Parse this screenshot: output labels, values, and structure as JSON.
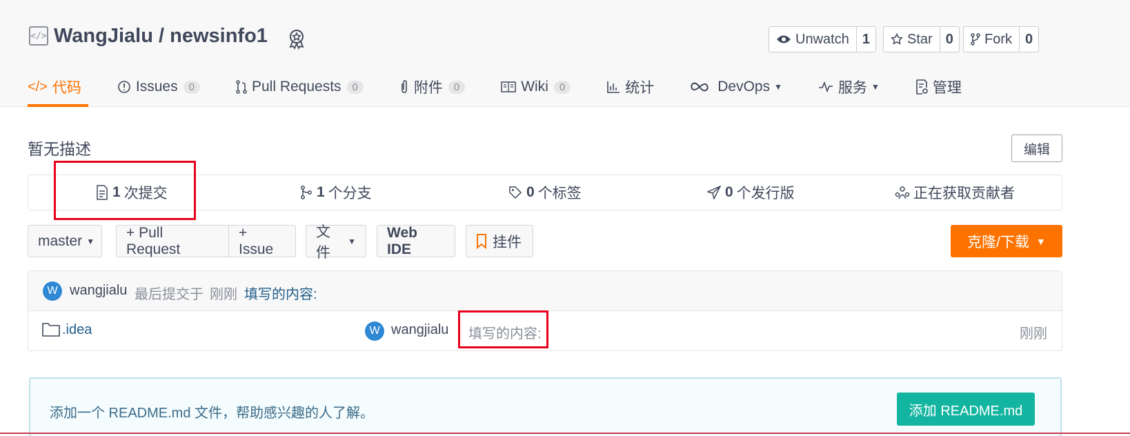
{
  "repo": {
    "owner": "WangJialu",
    "sep": " / ",
    "name": "newsinfo1"
  },
  "actions": [
    {
      "label": "Unwatch",
      "count": "1",
      "icon": "eye-icon"
    },
    {
      "label": "Star",
      "count": "0",
      "icon": "star-icon"
    },
    {
      "label": "Fork",
      "count": "0",
      "icon": "fork-icon"
    }
  ],
  "tabs": [
    {
      "label": "代码",
      "icon": "code-icon",
      "active": true
    },
    {
      "label": "Issues",
      "count": "0",
      "icon": "issue-icon"
    },
    {
      "label": "Pull Requests",
      "count": "0",
      "icon": "pull-request-icon"
    },
    {
      "label": "附件",
      "count": "0",
      "icon": "paperclip-icon"
    },
    {
      "label": "Wiki",
      "count": "0",
      "icon": "book-icon"
    },
    {
      "label": "统计",
      "icon": "bar-chart-icon"
    },
    {
      "label": "DevOps",
      "icon": "infinity-icon",
      "dropdown": true
    },
    {
      "label": "服务",
      "icon": "pulse-icon",
      "dropdown": true
    },
    {
      "label": "管理",
      "icon": "settings-doc-icon"
    }
  ],
  "description": "暂无描述",
  "edit_label": "编辑",
  "stats": [
    {
      "count": "1",
      "label": "次提交",
      "icon": "commit-icon"
    },
    {
      "count": "1",
      "label": "个分支",
      "icon": "branch-icon"
    },
    {
      "count": "0",
      "label": "个标签",
      "icon": "tag-icon"
    },
    {
      "count": "0",
      "label": "个发行版",
      "icon": "release-icon"
    },
    {
      "count": "",
      "label": "正在获取贡献者",
      "icon": "contributors-icon"
    }
  ],
  "toolbar": {
    "branch": "master",
    "pull_request": "+ Pull Request",
    "issue": "+ Issue",
    "files": "文件",
    "web_ide": "Web IDE",
    "widget": "挂件",
    "clone": "克隆/下载"
  },
  "last_commit": {
    "avatar_letter": "W",
    "author": "wangjialu",
    "text": "最后提交于",
    "time": "刚刚",
    "message": "填写的内容:"
  },
  "file_rows": [
    {
      "name": ".idea",
      "icon": "folder-icon",
      "avatar_letter": "W",
      "author": "wangjialu",
      "message": "填写的内容:",
      "time": "刚刚"
    }
  ],
  "readme": {
    "text": "添加一个 README.md 文件，帮助感兴趣的人了解。",
    "button": "添加 README.md"
  },
  "colors": {
    "accent": "#fe7300",
    "highlight": "#e8001c",
    "readme_button": "#13b5a0",
    "avatar": "#2f88d4"
  }
}
